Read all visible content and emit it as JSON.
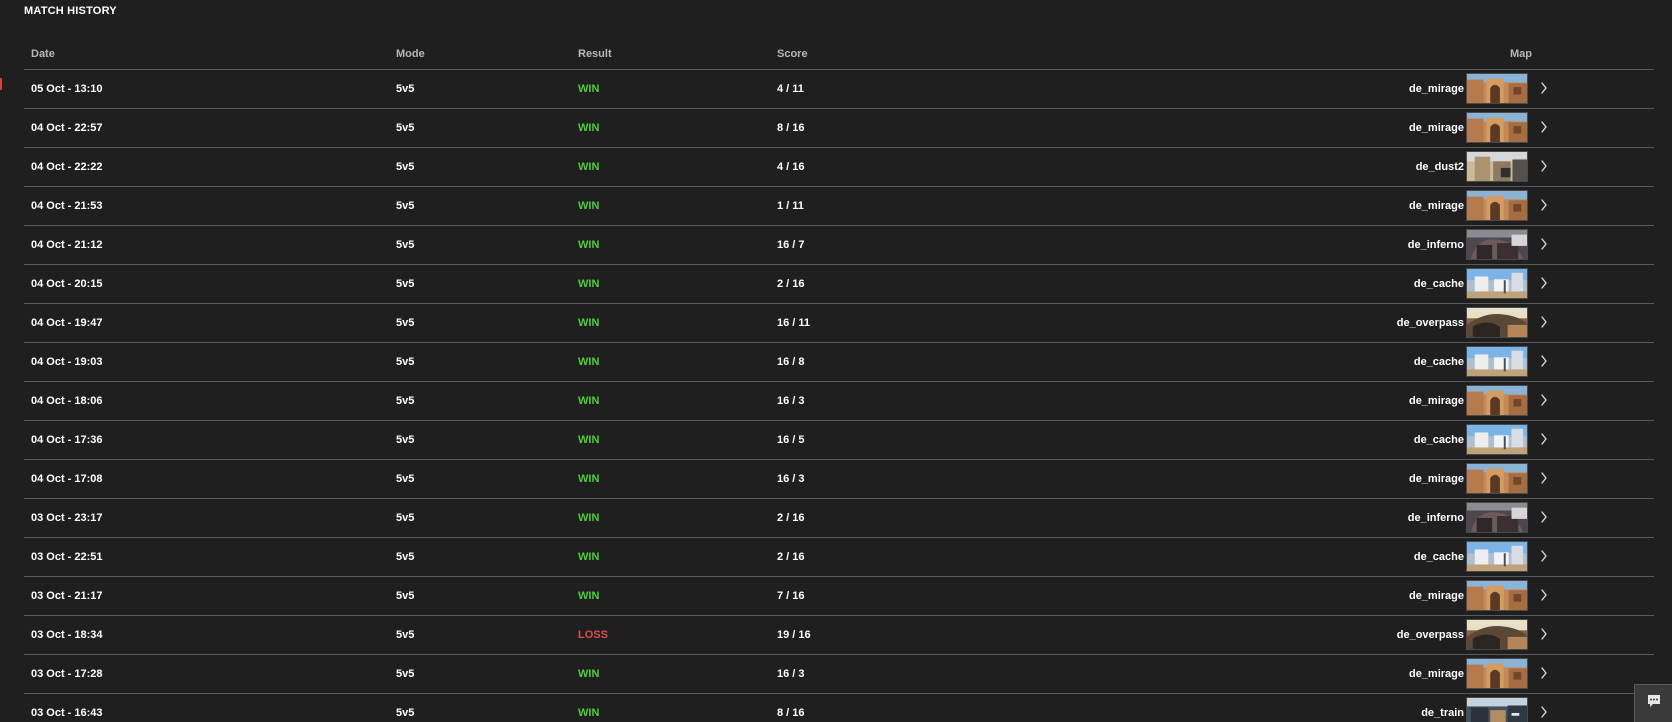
{
  "section_title": "MATCH HISTORY",
  "columns": {
    "date": "Date",
    "mode": "Mode",
    "result": "Result",
    "score": "Score",
    "map": "Map"
  },
  "colors": {
    "win": "#4ccf39",
    "loss": "#e04a4a",
    "row_divider": "#5a5a5a",
    "accent": "#d2443a"
  },
  "icons": {
    "row_action": "chevron-right-icon",
    "chat": "chat-icon"
  },
  "rows": [
    {
      "date": "05 Oct - 13:10",
      "mode": "5v5",
      "result": "WIN",
      "score": "4 / 11",
      "map": "de_mirage",
      "map_theme": "mirage"
    },
    {
      "date": "04 Oct - 22:57",
      "mode": "5v5",
      "result": "WIN",
      "score": "8 / 16",
      "map": "de_mirage",
      "map_theme": "mirage"
    },
    {
      "date": "04 Oct - 22:22",
      "mode": "5v5",
      "result": "WIN",
      "score": "4 / 16",
      "map": "de_dust2",
      "map_theme": "dust2"
    },
    {
      "date": "04 Oct - 21:53",
      "mode": "5v5",
      "result": "WIN",
      "score": "1 / 11",
      "map": "de_mirage",
      "map_theme": "mirage"
    },
    {
      "date": "04 Oct - 21:12",
      "mode": "5v5",
      "result": "WIN",
      "score": "16 / 7",
      "map": "de_inferno",
      "map_theme": "inferno"
    },
    {
      "date": "04 Oct - 20:15",
      "mode": "5v5",
      "result": "WIN",
      "score": "2 / 16",
      "map": "de_cache",
      "map_theme": "cache"
    },
    {
      "date": "04 Oct - 19:47",
      "mode": "5v5",
      "result": "WIN",
      "score": "16 / 11",
      "map": "de_overpass",
      "map_theme": "overpass"
    },
    {
      "date": "04 Oct - 19:03",
      "mode": "5v5",
      "result": "WIN",
      "score": "16 / 8",
      "map": "de_cache",
      "map_theme": "cache"
    },
    {
      "date": "04 Oct - 18:06",
      "mode": "5v5",
      "result": "WIN",
      "score": "16 / 3",
      "map": "de_mirage",
      "map_theme": "mirage"
    },
    {
      "date": "04 Oct - 17:36",
      "mode": "5v5",
      "result": "WIN",
      "score": "16 / 5",
      "map": "de_cache",
      "map_theme": "cache"
    },
    {
      "date": "04 Oct - 17:08",
      "mode": "5v5",
      "result": "WIN",
      "score": "16 / 3",
      "map": "de_mirage",
      "map_theme": "mirage"
    },
    {
      "date": "03 Oct - 23:17",
      "mode": "5v5",
      "result": "WIN",
      "score": "2 / 16",
      "map": "de_inferno",
      "map_theme": "inferno"
    },
    {
      "date": "03 Oct - 22:51",
      "mode": "5v5",
      "result": "WIN",
      "score": "2 / 16",
      "map": "de_cache",
      "map_theme": "cache"
    },
    {
      "date": "03 Oct - 21:17",
      "mode": "5v5",
      "result": "WIN",
      "score": "7 / 16",
      "map": "de_mirage",
      "map_theme": "mirage"
    },
    {
      "date": "03 Oct - 18:34",
      "mode": "5v5",
      "result": "LOSS",
      "score": "19 / 16",
      "map": "de_overpass",
      "map_theme": "overpass"
    },
    {
      "date": "03 Oct - 17:28",
      "mode": "5v5",
      "result": "WIN",
      "score": "16 / 3",
      "map": "de_mirage",
      "map_theme": "mirage"
    },
    {
      "date": "03 Oct - 16:43",
      "mode": "5v5",
      "result": "WIN",
      "score": "8 / 16",
      "map": "de_train",
      "map_theme": "train"
    }
  ]
}
